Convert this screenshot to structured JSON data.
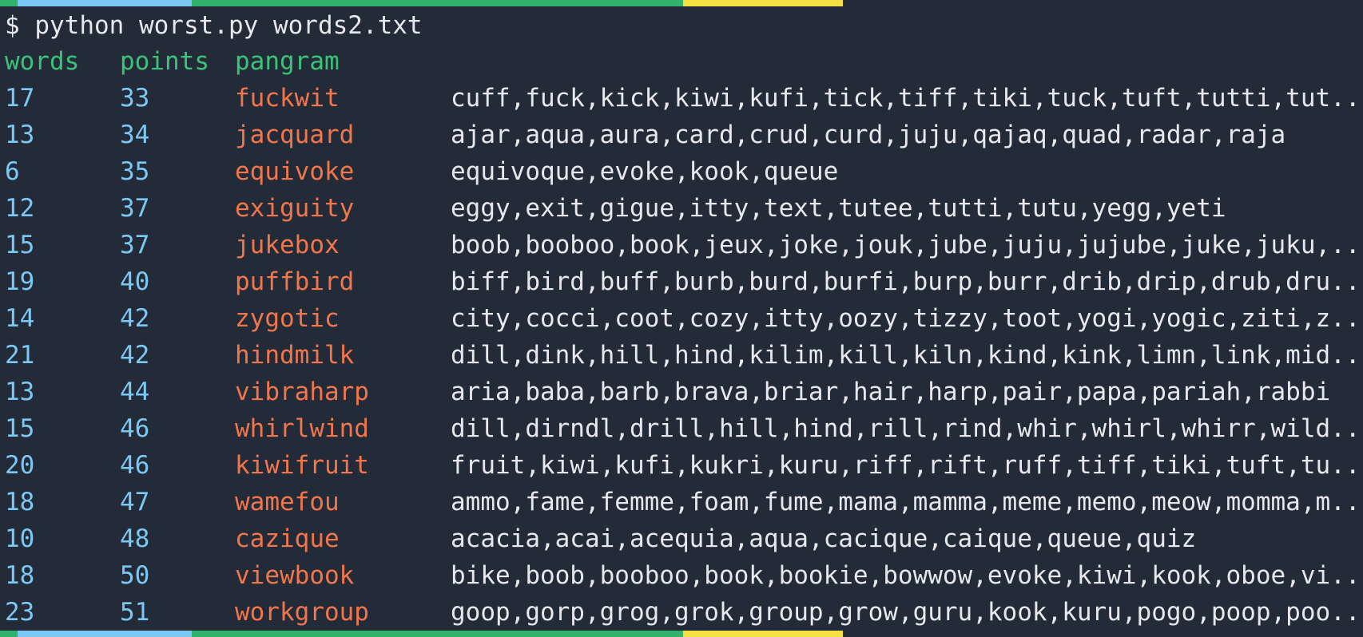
{
  "terminal": {
    "command_prompt": "$",
    "command": " python worst.py words2.txt"
  },
  "table": {
    "headers": {
      "words": "words",
      "points": "points",
      "pangram": "pangram"
    },
    "rows": [
      {
        "words": "17",
        "points": "33",
        "pangram": "fuckwit",
        "list": "cuff,fuck,kick,kiwi,kufi,tick,tiff,tiki,tuck,tuft,tutti,tut..."
      },
      {
        "words": "13",
        "points": "34",
        "pangram": "jacquard",
        "list": "ajar,aqua,aura,card,crud,curd,juju,qajaq,quad,radar,raja"
      },
      {
        "words": "6",
        "points": "35",
        "pangram": "equivoke",
        "list": "equivoque,evoke,kook,queue"
      },
      {
        "words": "12",
        "points": "37",
        "pangram": "exiguity",
        "list": "eggy,exit,gigue,itty,text,tutee,tutti,tutu,yegg,yeti"
      },
      {
        "words": "15",
        "points": "37",
        "pangram": "jukebox",
        "list": "boob,booboo,book,jeux,joke,jouk,jube,juju,jujube,juke,juku,..."
      },
      {
        "words": "19",
        "points": "40",
        "pangram": "puffbird",
        "list": "biff,bird,buff,burb,burd,burfi,burp,burr,drib,drip,drub,dru..."
      },
      {
        "words": "14",
        "points": "42",
        "pangram": "zygotic",
        "list": "city,cocci,coot,cozy,itty,oozy,tizzy,toot,yogi,yogic,ziti,z..."
      },
      {
        "words": "21",
        "points": "42",
        "pangram": "hindmilk",
        "list": "dill,dink,hill,hind,kilim,kill,kiln,kind,kink,limn,link,mid..."
      },
      {
        "words": "13",
        "points": "44",
        "pangram": "vibraharp",
        "list": "aria,baba,barb,brava,briar,hair,harp,pair,papa,pariah,rabbi"
      },
      {
        "words": "15",
        "points": "46",
        "pangram": "whirlwind",
        "list": "dill,dirndl,drill,hill,hind,rill,rind,whir,whirl,whirr,wild..."
      },
      {
        "words": "20",
        "points": "46",
        "pangram": "kiwifruit",
        "list": "fruit,kiwi,kufi,kukri,kuru,riff,rift,ruff,tiff,tiki,tuft,tu..."
      },
      {
        "words": "18",
        "points": "47",
        "pangram": "wamefou",
        "list": "ammo,fame,femme,foam,fume,mama,mamma,meme,memo,meow,momma,m..."
      },
      {
        "words": "10",
        "points": "48",
        "pangram": "cazique",
        "list": "acacia,acai,acequia,aqua,cacique,caique,queue,quiz"
      },
      {
        "words": "18",
        "points": "50",
        "pangram": "viewbook",
        "list": "bike,boob,booboo,book,bookie,bowwow,evoke,kiwi,kook,oboe,vi..."
      },
      {
        "words": "23",
        "points": "51",
        "pangram": "workgroup",
        "list": "goop,gorp,grog,grok,group,grow,guru,kook,kuru,pogo,poop,poo..."
      }
    ]
  },
  "colors": {
    "background": "#232b38",
    "header": "#3dc27a",
    "number": "#7cc8f5",
    "pangram": "#f2764c",
    "text": "#e6e8ee"
  }
}
